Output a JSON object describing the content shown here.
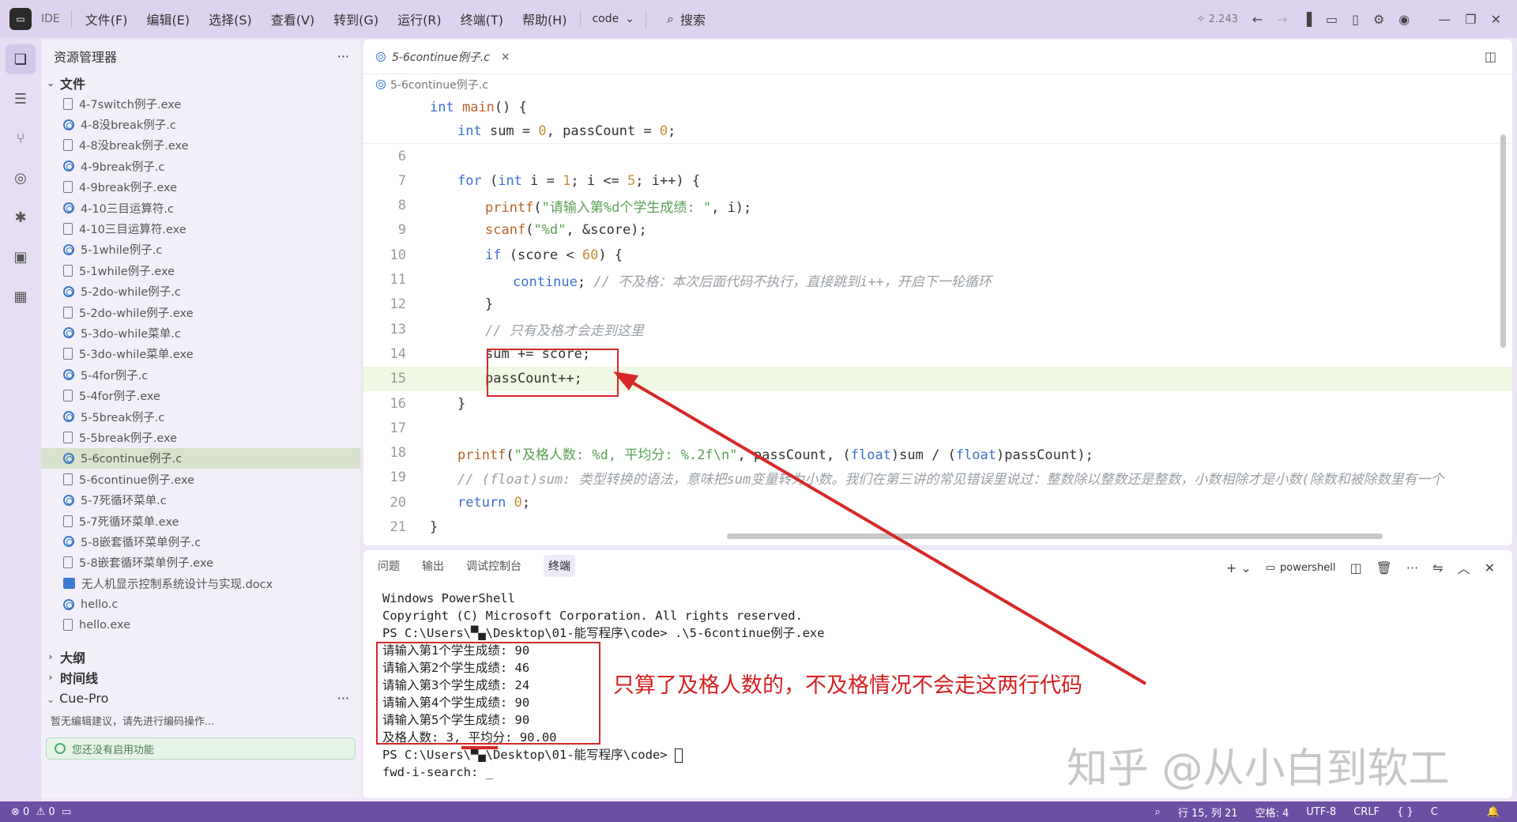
{
  "titlebar": {
    "ide_label": "IDE",
    "menu": [
      "文件(F)",
      "编辑(E)",
      "选择(S)",
      "查看(V)",
      "转到(G)",
      "运行(R)",
      "终端(T)",
      "帮助(H)"
    ],
    "code_label": "code",
    "search_label": "搜索",
    "version": "2.243"
  },
  "sidebar": {
    "title": "资源管理器",
    "section_files": "文件",
    "files": [
      {
        "name": "4-7switch例子.exe",
        "type": "exe"
      },
      {
        "name": "4-8没break例子.c",
        "type": "c"
      },
      {
        "name": "4-8没break例子.exe",
        "type": "exe"
      },
      {
        "name": "4-9break例子.c",
        "type": "c"
      },
      {
        "name": "4-9break例子.exe",
        "type": "exe"
      },
      {
        "name": "4-10三目运算符.c",
        "type": "c"
      },
      {
        "name": "4-10三目运算符.exe",
        "type": "exe"
      },
      {
        "name": "5-1while例子.c",
        "type": "c"
      },
      {
        "name": "5-1while例子.exe",
        "type": "exe"
      },
      {
        "name": "5-2do-while例子.c",
        "type": "c"
      },
      {
        "name": "5-2do-while例子.exe",
        "type": "exe"
      },
      {
        "name": "5-3do-while菜单.c",
        "type": "c"
      },
      {
        "name": "5-3do-while菜单.exe",
        "type": "exe"
      },
      {
        "name": "5-4for例子.c",
        "type": "c"
      },
      {
        "name": "5-4for例子.exe",
        "type": "exe"
      },
      {
        "name": "5-5break例子.c",
        "type": "c"
      },
      {
        "name": "5-5break例子.exe",
        "type": "exe"
      },
      {
        "name": "5-6continue例子.c",
        "type": "c",
        "selected": true
      },
      {
        "name": "5-6continue例子.exe",
        "type": "exe"
      },
      {
        "name": "5-7死循环菜单.c",
        "type": "c"
      },
      {
        "name": "5-7死循环菜单.exe",
        "type": "exe"
      },
      {
        "name": "5-8嵌套循环菜单例子.c",
        "type": "c"
      },
      {
        "name": "5-8嵌套循环菜单例子.exe",
        "type": "exe"
      },
      {
        "name": "无人机显示控制系统设计与实现.docx",
        "type": "docx"
      },
      {
        "name": "hello.c",
        "type": "c"
      },
      {
        "name": "hello.exe",
        "type": "exe"
      }
    ],
    "section_outline": "大纲",
    "section_timeline": "时间线",
    "section_cue": "Cue-Pro",
    "cue_message": "暂无编辑建议，请先进行编码操作...",
    "cue_button": "您还没有启用功能"
  },
  "editor": {
    "tab_label": "5-6continue例子.c",
    "breadcrumb": "5-6continue例子.c",
    "sticky_line": "int main() {",
    "sticky_line2": "int sum = 0, passCount = 0;",
    "lines": [
      {
        "n": "6",
        "text": ""
      },
      {
        "n": "7",
        "text": "for (int i = 1; i <= 5; i++) {"
      },
      {
        "n": "8",
        "text": "printf(\"请输入第%d个学生成绩: \", i);"
      },
      {
        "n": "9",
        "text": "scanf(\"%d\", &score);"
      },
      {
        "n": "10",
        "text": "if (score < 60) {"
      },
      {
        "n": "11",
        "text": "continue; // 不及格：本次后面代码不执行，直接跳到i++，开启下一轮循环"
      },
      {
        "n": "12",
        "text": "}"
      },
      {
        "n": "13",
        "text": "// 只有及格才会走到这里"
      },
      {
        "n": "14",
        "text": "sum += score;"
      },
      {
        "n": "15",
        "text": "passCount++;"
      },
      {
        "n": "16",
        "text": "}"
      },
      {
        "n": "17",
        "text": ""
      },
      {
        "n": "18",
        "text": "printf(\"及格人数: %d, 平均分: %.2f\\n\", passCount, (float)sum / (float)passCount);"
      },
      {
        "n": "19",
        "text": "// (float)sum: 类型转换的语法，意味把sum变量转为小数。我们在第三讲的常见错误里说过：整数除以整数还是整数，小数相除才是小数(除数和被除数里有一个"
      },
      {
        "n": "20",
        "text": "return 0;"
      },
      {
        "n": "21",
        "text": "}"
      }
    ]
  },
  "panel": {
    "tabs": [
      "问题",
      "输出",
      "调试控制台",
      "终端"
    ],
    "shell_label": "powershell",
    "terminal_lines": [
      "Windows PowerShell",
      "Copyright (C) Microsoft Corporation. All rights reserved.",
      "PS C:\\Users\\▀▄\\Desktop\\01-能写程序\\code> .\\5-6continue例子.exe",
      "请输入第1个学生成绩: 90",
      "请输入第2个学生成绩: 46",
      "请输入第3个学生成绩: 24",
      "请输入第4个学生成绩: 90",
      "请输入第5个学生成绩: 90",
      "及格人数: 3, 平均分: 90.00",
      "PS C:\\Users\\▀▄\\Desktop\\01-能写程序\\code> ",
      "fwd-i-search: _"
    ]
  },
  "statusbar": {
    "errors": "0",
    "warnings": "0",
    "position": "行 15, 列 21",
    "spaces": "空格: 4",
    "encoding": "UTF-8",
    "eol": "CRLF",
    "braces": "{ }",
    "language": "C"
  },
  "annotation": {
    "text": "只算了及格人数的，不及格情况不会走这两行代码",
    "color": "#d61f1f"
  },
  "watermark": {
    "text": "知乎 @从小白到软工"
  }
}
